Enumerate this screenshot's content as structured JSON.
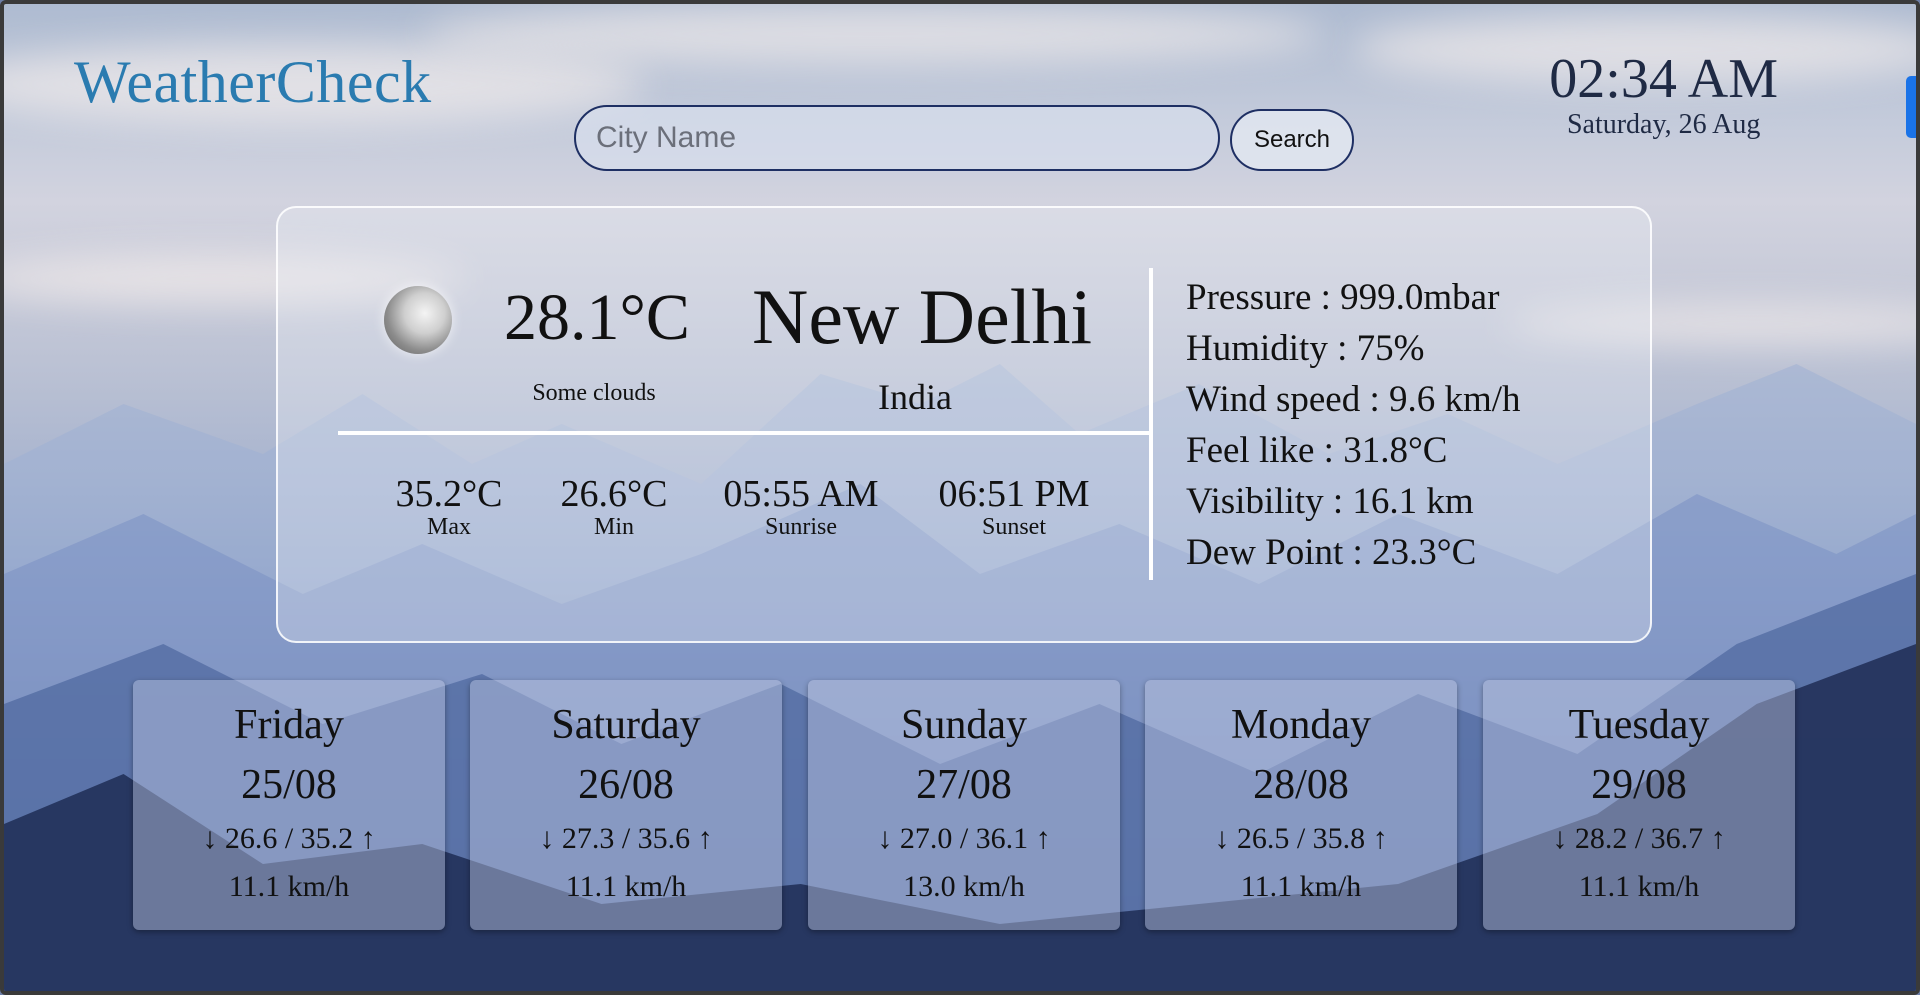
{
  "app": {
    "title": "WeatherCheck"
  },
  "clock": {
    "time": "02:34 AM",
    "date": "Saturday, 26 Aug"
  },
  "search": {
    "placeholder": "City Name",
    "button_label": "Search"
  },
  "current": {
    "icon": "moon-clouds-icon",
    "temperature": "28.1°C",
    "description": "Some clouds",
    "city": "New Delhi",
    "country": "India",
    "stats": [
      {
        "value": "35.2°C",
        "label": "Max"
      },
      {
        "value": "26.6°C",
        "label": "Min"
      },
      {
        "value": "05:55 AM",
        "label": "Sunrise"
      },
      {
        "value": "06:51 PM",
        "label": "Sunset"
      }
    ],
    "details": [
      "Pressure : 999.0mbar",
      "Humidity : 75%",
      "Wind speed : 9.6 km/h",
      "Feel like : 31.8°C",
      "Visibility : 16.1 km",
      "Dew Point : 23.3°C"
    ]
  },
  "forecast": [
    {
      "day": "Friday",
      "date": "25/08",
      "range": "↓ 26.6 / 35.2 ↑",
      "wind": "11.1 km/h"
    },
    {
      "day": "Saturday",
      "date": "26/08",
      "range": "↓ 27.3 / 35.6 ↑",
      "wind": "11.1 km/h"
    },
    {
      "day": "Sunday",
      "date": "27/08",
      "range": "↓ 27.0 / 36.1 ↑",
      "wind": "13.0 km/h"
    },
    {
      "day": "Monday",
      "date": "28/08",
      "range": "↓ 26.5 / 35.8 ↑",
      "wind": "11.1 km/h"
    },
    {
      "day": "Tuesday",
      "date": "29/08",
      "range": "↓ 28.2 / 36.7 ↑",
      "wind": "11.1 km/h"
    }
  ]
}
